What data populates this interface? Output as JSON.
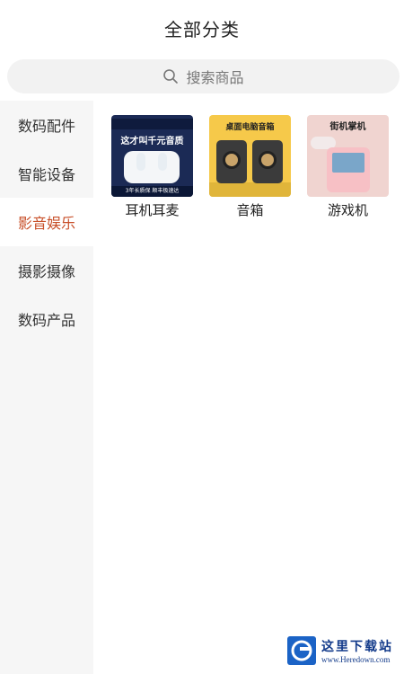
{
  "header": {
    "title": "全部分类"
  },
  "search": {
    "placeholder": "搜索商品",
    "icon": "search-icon"
  },
  "sidebar": {
    "items": [
      {
        "label": "数码配件",
        "active": false
      },
      {
        "label": "智能设备",
        "active": false
      },
      {
        "label": "影音娱乐",
        "active": true
      },
      {
        "label": "摄影摄像",
        "active": false
      },
      {
        "label": "数码产品",
        "active": false
      }
    ],
    "active_color": "#c8502a"
  },
  "products": [
    {
      "label": "耳机耳麦",
      "image": {
        "headline": "这才叫千元音质",
        "footer": "3年长质保 顺丰极速达"
      }
    },
    {
      "label": "音箱",
      "image": {
        "headline": "桌面电脑音箱"
      }
    },
    {
      "label": "游戏机",
      "image": {
        "headline": "街机掌机"
      }
    }
  ],
  "watermark": {
    "cn": "这里下载站",
    "en": "www.Heredown.com"
  }
}
